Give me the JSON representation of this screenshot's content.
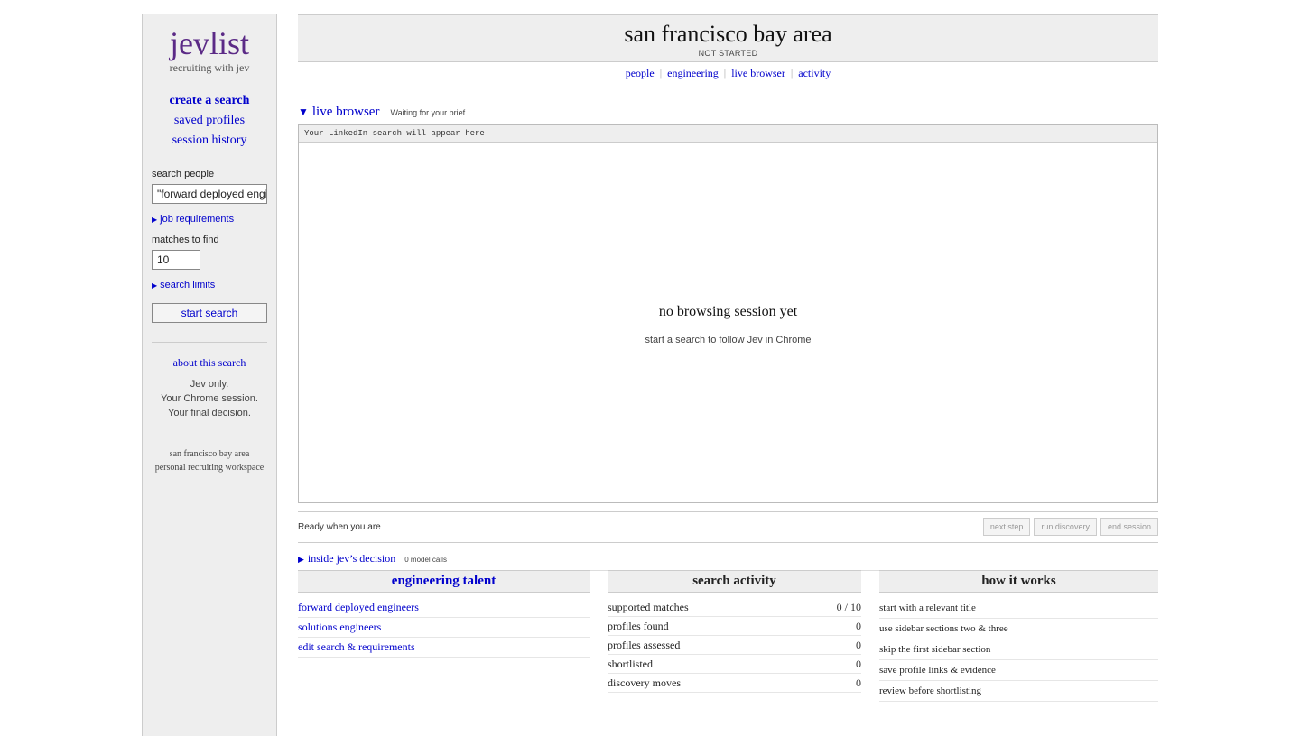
{
  "sidebar": {
    "logo": "jevlist",
    "tagline": "recruiting with jev",
    "nav": {
      "create": "create a search",
      "saved": "saved profiles",
      "history": "session history"
    },
    "search_label": "search people",
    "search_value": "\"forward deployed engine",
    "job_requirements": "job requirements",
    "matches_label": "matches to find",
    "matches_value": "10",
    "search_limits": "search limits",
    "start_button": "start search",
    "about_link": "about this search",
    "about_lines": [
      "Jev only.",
      "Your Chrome session.",
      "Your final decision."
    ],
    "footer_lines": [
      "san francisco bay area",
      "personal recruiting workspace"
    ]
  },
  "header": {
    "title": "san francisco bay area",
    "status": "NOT STARTED"
  },
  "topnav": [
    "people",
    "engineering",
    "live browser",
    "activity"
  ],
  "live_browser": {
    "title": "live browser",
    "note": "Waiting for your brief",
    "bar_text": "Your LinkedIn search will appear here",
    "empty_title": "no browsing session yet",
    "empty_sub": "start a search to follow Jev in Chrome"
  },
  "statusbar": {
    "text": "Ready when you are",
    "buttons": [
      "next step",
      "run discovery",
      "end session"
    ]
  },
  "decision": {
    "title": "inside jev’s decision",
    "note": "0 model calls"
  },
  "engineering_talent": {
    "title": "engineering talent",
    "links": [
      "forward deployed engineers",
      "solutions engineers",
      "edit search & requirements"
    ]
  },
  "search_activity": {
    "title": "search activity",
    "rows": [
      {
        "label": "supported matches",
        "value": "0 / 10"
      },
      {
        "label": "profiles found",
        "value": "0"
      },
      {
        "label": "profiles assessed",
        "value": "0"
      },
      {
        "label": "shortlisted",
        "value": "0"
      },
      {
        "label": "discovery moves",
        "value": "0"
      }
    ]
  },
  "how_it_works": {
    "title": "how it works",
    "steps": [
      "start with a relevant title",
      "use sidebar sections two & three",
      "skip the first sidebar section",
      "save profile links & evidence",
      "review before shortlisting"
    ]
  }
}
